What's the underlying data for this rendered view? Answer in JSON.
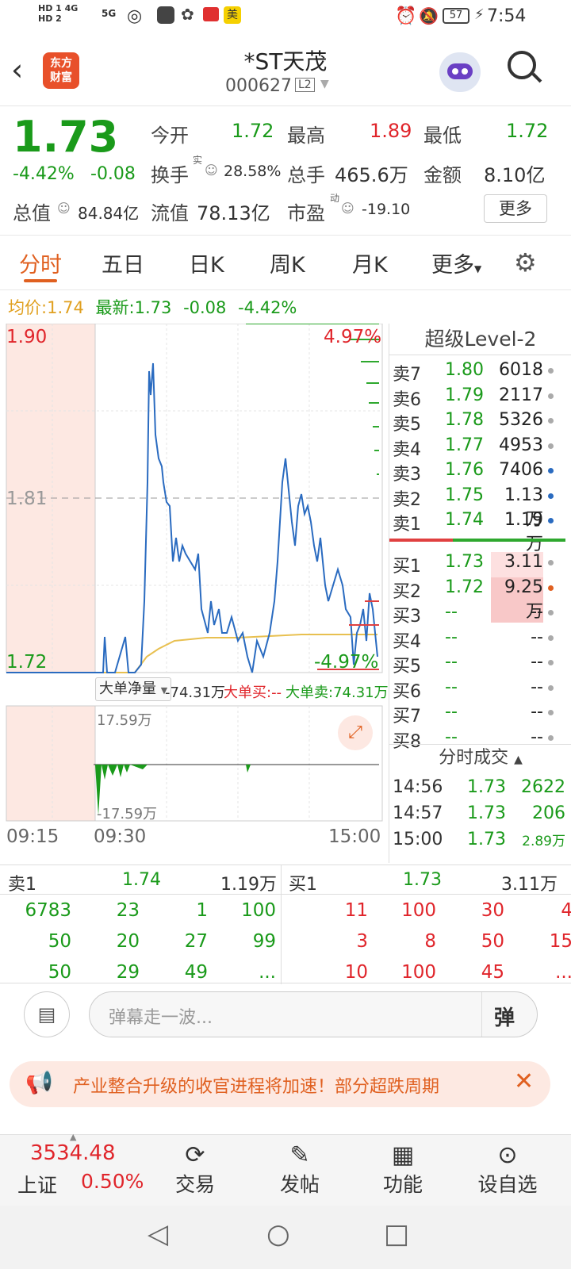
{
  "status_bar": {
    "left_icons": [
      "HD 1 4G",
      "HD 2",
      "5G"
    ],
    "battery": "57",
    "time": "7:54"
  },
  "header": {
    "logo_line1": "东方",
    "logo_line2": "财富",
    "title": "*ST天茂",
    "code": "000627",
    "badge": "L2"
  },
  "quote": {
    "price": "1.73",
    "change_pct": "-4.42%",
    "change": "-0.08",
    "open_label": "今开",
    "open": "1.72",
    "high_label": "最高",
    "high": "1.89",
    "low_label": "最低",
    "low": "1.72",
    "turnover_label": "换手",
    "turnover_sup": "实",
    "turnover": "28.58%",
    "volume_label": "总手",
    "volume": "465.6万",
    "amount_label": "金额",
    "amount": "8.10亿",
    "mcap_label": "总值",
    "mcap": "84.84亿",
    "float_label": "流值",
    "float": "78.13亿",
    "pe_label": "市盈",
    "pe_sup": "动",
    "pe": "-19.10",
    "more": "更多"
  },
  "tabs": [
    "分时",
    "五日",
    "日K",
    "周K",
    "月K",
    "更多"
  ],
  "avgline": {
    "avg_label": "均价:",
    "avg": "1.74",
    "latest_label": "最新:",
    "latest": "1.73",
    "chg": "-0.08",
    "pct": "-4.42%"
  },
  "chart": {
    "y_top": "1.90",
    "y_mid": "1.81",
    "y_bottom": "1.72",
    "pct_top": "4.97%",
    "pct_bottom": "-4.97%",
    "sub_label": "大单净量",
    "sub_value": "-74.31万",
    "big_buy": "大单买:--",
    "big_sell": "大单卖:74.31万",
    "sub_top": "17.59万",
    "sub_bottom": "-17.59万",
    "t_start": "09:15",
    "t_open": "09:30",
    "t_close": "15:00"
  },
  "level2": {
    "title": "超级Level-2",
    "asks": [
      {
        "label": "卖7",
        "price": "1.80",
        "vol": "6018"
      },
      {
        "label": "卖6",
        "price": "1.79",
        "vol": "2117"
      },
      {
        "label": "卖5",
        "price": "1.78",
        "vol": "5326"
      },
      {
        "label": "卖4",
        "price": "1.77",
        "vol": "4953"
      },
      {
        "label": "卖3",
        "price": "1.76",
        "vol": "7406"
      },
      {
        "label": "卖2",
        "price": "1.75",
        "vol": "1.13万"
      },
      {
        "label": "卖1",
        "price": "1.74",
        "vol": "1.19万"
      }
    ],
    "bids": [
      {
        "label": "买1",
        "price": "1.73",
        "vol": "3.11万"
      },
      {
        "label": "买2",
        "price": "1.72",
        "vol": "9.25万"
      },
      {
        "label": "买3",
        "price": "--",
        "vol": "--"
      },
      {
        "label": "买4",
        "price": "--",
        "vol": "--"
      },
      {
        "label": "买5",
        "price": "--",
        "vol": "--"
      },
      {
        "label": "买6",
        "price": "--",
        "vol": "--"
      },
      {
        "label": "买7",
        "price": "--",
        "vol": "--"
      },
      {
        "label": "买8",
        "price": "--",
        "vol": "--"
      }
    ],
    "trades_title": "分时成交",
    "trades": [
      {
        "time": "14:56",
        "price": "1.73",
        "vol": "2622"
      },
      {
        "time": "14:57",
        "price": "1.73",
        "vol": "206"
      },
      {
        "time": "15:00",
        "price": "1.73",
        "vol": "2.89万"
      }
    ]
  },
  "book": {
    "sell_label": "卖1",
    "sell_price": "1.74",
    "sell_vol": "1.19万",
    "buy_label": "买1",
    "buy_price": "1.73",
    "buy_vol": "3.11万",
    "sell_rows": [
      [
        "6783",
        "23",
        "1",
        "100"
      ],
      [
        "50",
        "20",
        "27",
        "99"
      ],
      [
        "50",
        "29",
        "49",
        "..."
      ]
    ],
    "buy_rows": [
      [
        "11",
        "100",
        "30",
        "4"
      ],
      [
        "3",
        "8",
        "50",
        "15"
      ],
      [
        "10",
        "100",
        "45",
        "..."
      ]
    ]
  },
  "comment": {
    "placeholder": "弹幕走一波...",
    "send": "弹"
  },
  "banner": {
    "text": "产业整合升级的收官进程将加速！部分超跌周期"
  },
  "nav": {
    "index_value": "3534.48",
    "index_name": "上证",
    "index_pct": "0.50%",
    "items": [
      "交易",
      "发帖",
      "功能",
      "设自选"
    ]
  }
}
